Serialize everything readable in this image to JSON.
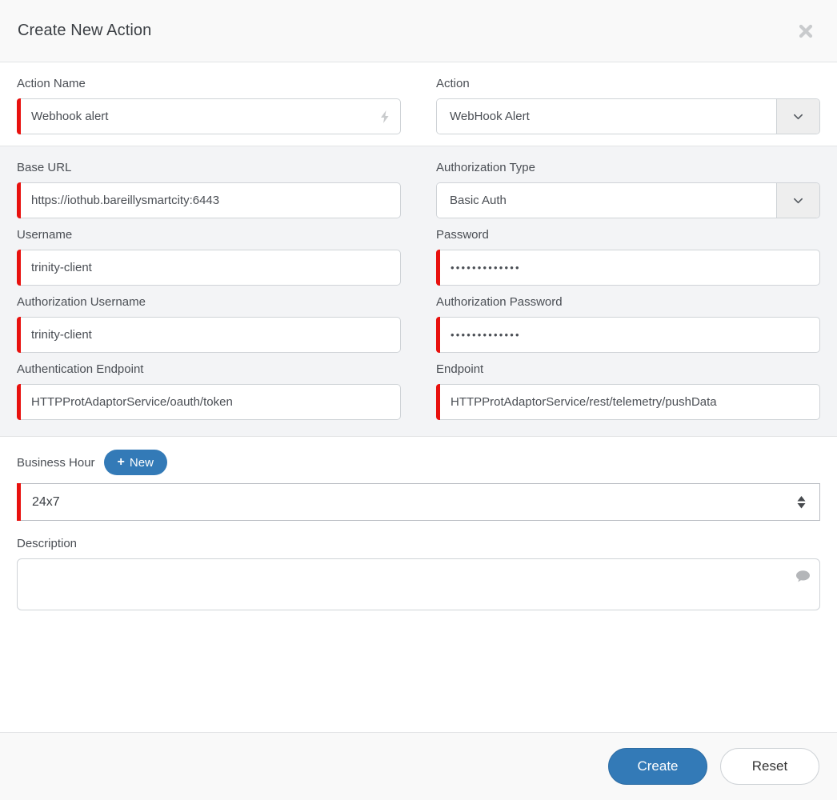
{
  "dialog": {
    "title": "Create New Action",
    "close_icon": "close-icon"
  },
  "section_top": {
    "fields": {
      "action_name": {
        "label": "Action Name",
        "value": "Webhook alert",
        "placeholder": "",
        "icon": "lightning-bolt-icon",
        "required": true
      },
      "action": {
        "label": "Action",
        "value": "WebHook Alert",
        "toggle_icon": "chevron-down-icon",
        "required": false
      }
    }
  },
  "section_config": {
    "fields": {
      "base_url": {
        "label": "Base URL",
        "value": "https://iothub.bareillysmartcity:6443",
        "placeholder": "",
        "required": true
      },
      "authorization_type": {
        "label": "Authorization Type",
        "value": "Basic Auth",
        "toggle_icon": "chevron-down-icon",
        "required": false
      },
      "username": {
        "label": "Username",
        "value": "trinity-client",
        "placeholder": "",
        "required": true
      },
      "password": {
        "label": "Password",
        "value": "•••••••••••••",
        "placeholder": "",
        "required": true
      },
      "authorization_username": {
        "label": "Authorization Username",
        "value": "trinity-client",
        "placeholder": "",
        "required": true
      },
      "authorization_password": {
        "label": "Authorization Password",
        "value": "•••••••••••••",
        "placeholder": "",
        "required": true
      },
      "authentication_endpoint": {
        "label": "Authentication Endpoint",
        "value": "HTTPProtAdaptorService/oauth/token",
        "placeholder": "",
        "required": true
      },
      "endpoint": {
        "label": "Endpoint",
        "value": "HTTPProtAdaptorService/rest/telemetry/pushData",
        "placeholder": "",
        "required": true
      }
    }
  },
  "section_bottom": {
    "business_hour": {
      "label": "Business Hour",
      "new_button_label": "New",
      "new_button_icon": "plus-icon",
      "value": "24x7",
      "options": [
        "24x7"
      ],
      "stepper_icon": "up-down-arrows-icon",
      "required": true
    },
    "description": {
      "label": "Description",
      "value": "",
      "placeholder": "",
      "icon": "comment-bubble-icon",
      "required": false
    }
  },
  "footer": {
    "create_label": "Create",
    "reset_label": "Reset"
  },
  "colors": {
    "primary": "#337ab7",
    "required_marker": "#e8110e",
    "header_bg": "#f9f9f9",
    "section_bg": "#f3f4f6",
    "border": "#cfd3d7"
  }
}
